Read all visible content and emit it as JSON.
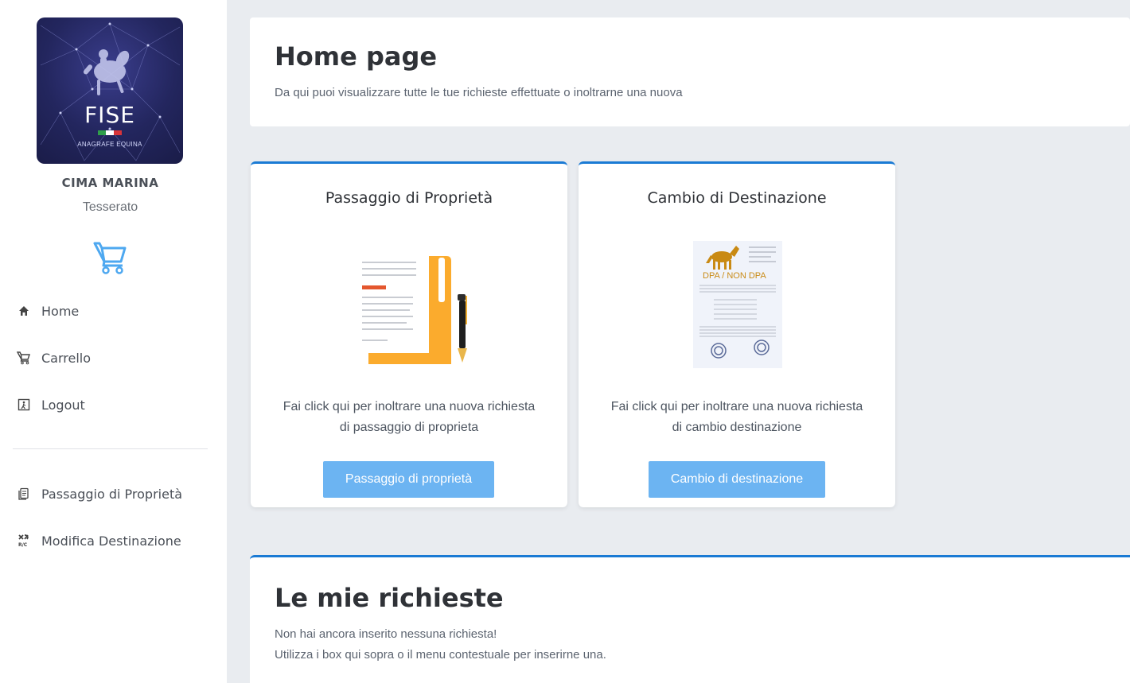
{
  "logo": {
    "title": "FISE",
    "subtitle": "ANAGRAFE EQUINA"
  },
  "user": {
    "name": "CIMA MARINA",
    "role": "Tesserato"
  },
  "nav": {
    "home": "Home",
    "cart": "Carrello",
    "logout": "Logout",
    "ownership": "Passaggio di Proprietà",
    "destination": "Modifica Destinazione"
  },
  "header": {
    "title": "Home page",
    "subtitle": "Da qui puoi visualizzare tutte le tue richieste effettuate o inoltrarne una nuova"
  },
  "cards": [
    {
      "title": "Passaggio di Proprietà",
      "text": "Fai click qui per inoltrare una nuova richiesta di passaggio di proprieta",
      "button": "Passaggio di proprietà"
    },
    {
      "title": "Cambio di Destinazione",
      "text": "Fai click qui per inoltrare una nuova richiesta di cambio destinazione",
      "button": "Cambio di destinazione",
      "doc_label": "DPA / NON DPA"
    }
  ],
  "requests": {
    "title": "Le mie richieste",
    "line1": "Non hai ancora inserito nessuna richiesta!",
    "line2": "Utilizza i box qui sopra o il menu contestuale per inserirne una."
  },
  "colors": {
    "accent": "#1a7ad4",
    "button": "#6cb4f2",
    "cart_icon": "#4ea8f0"
  },
  "icons": {
    "home": "home-icon",
    "cart": "cart-icon",
    "logout": "logout-icon",
    "ownership": "document-stack-icon",
    "destination": "horse-rc-icon"
  }
}
